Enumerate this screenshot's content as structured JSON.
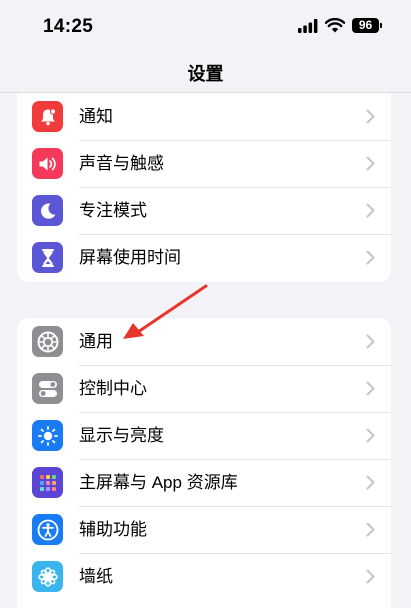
{
  "status_bar": {
    "time": "14:25",
    "battery": "96"
  },
  "nav": {
    "title": "设置"
  },
  "groups": [
    {
      "items": [
        {
          "label": "通知",
          "icon": "bell-icon",
          "color": "#f23c3c"
        },
        {
          "label": "声音与触感",
          "icon": "speaker-icon",
          "color": "#f5395a"
        },
        {
          "label": "专注模式",
          "icon": "moon-icon",
          "color": "#5b56d6"
        },
        {
          "label": "屏幕使用时间",
          "icon": "hourglass-icon",
          "color": "#5b56d6"
        }
      ]
    },
    {
      "items": [
        {
          "label": "通用",
          "icon": "gear-icon",
          "color": "#8e8e93"
        },
        {
          "label": "控制中心",
          "icon": "toggles-icon",
          "color": "#8e8e93"
        },
        {
          "label": "显示与亮度",
          "icon": "sun-icon",
          "color": "#1a7cf5"
        },
        {
          "label": "主屏幕与 App 资源库",
          "icon": "app-grid-icon",
          "color": "#5b45d6"
        },
        {
          "label": "辅助功能",
          "icon": "accessibility-icon",
          "color": "#1a7cf5"
        },
        {
          "label": "墙纸",
          "icon": "flower-icon",
          "color": "#39b4ec"
        }
      ]
    }
  ],
  "annotation": {
    "arrow_color": "#e8352b"
  }
}
